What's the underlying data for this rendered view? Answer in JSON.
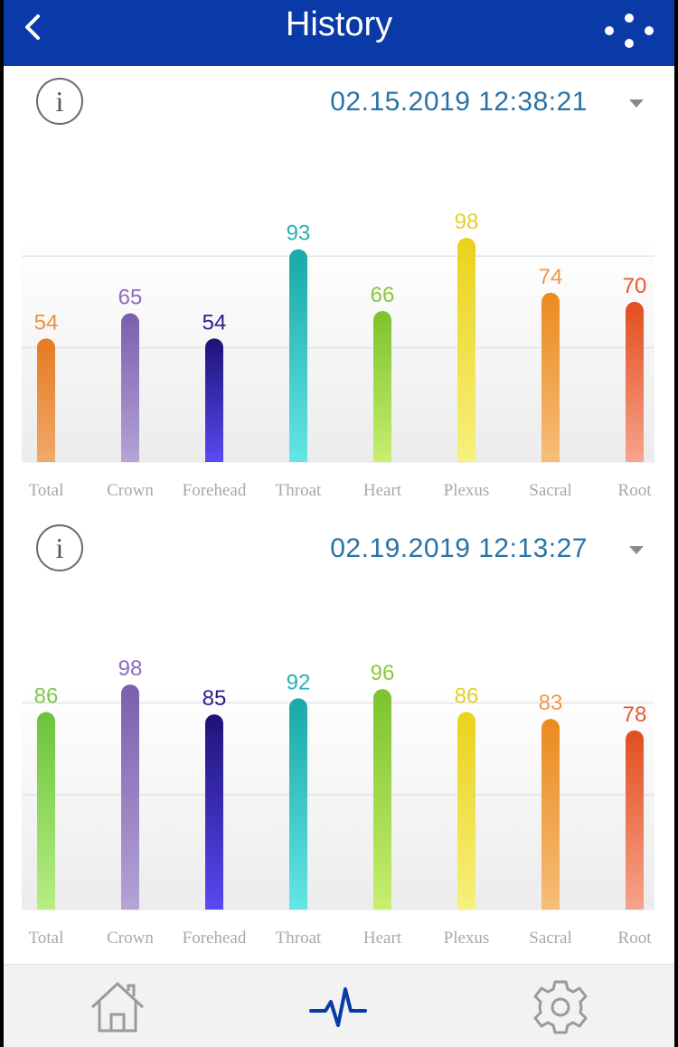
{
  "header": {
    "title": "History",
    "back_icon": "chevron-left-icon",
    "menu_icon": "dots-menu-icon"
  },
  "colors": {
    "header_bg": "#0a3aa8",
    "date_text": "#2874a6",
    "nav_active": "#0a3aa8",
    "nav_inactive": "#9a9a9a"
  },
  "history_entries": [
    {
      "info_label": "i",
      "date": "02.15.2019 12:38:21",
      "chart_data": {
        "type": "bar",
        "categories": [
          "Total",
          "Crown",
          "Forehead",
          "Throat",
          "Heart",
          "Plexus",
          "Sacral",
          "Root"
        ],
        "values": [
          54,
          65,
          54,
          93,
          66,
          98,
          74,
          70
        ],
        "value_labels": [
          "54",
          "65",
          "54",
          "93",
          "66",
          "98",
          "74",
          "70"
        ],
        "ylim": [
          0,
          100
        ],
        "grid": true,
        "colors": [
          [
            "#f0a869",
            "#e67b22"
          ],
          [
            "#b3a3d6",
            "#7b5fae"
          ],
          [
            "#5a48f0",
            "#1d1378"
          ],
          [
            "#62e5e5",
            "#1aa8a8"
          ],
          [
            "#c7ee6f",
            "#7cc32e"
          ],
          [
            "#f7f07c",
            "#ead21a"
          ],
          [
            "#f6bd78",
            "#ea8b1e"
          ],
          [
            "#f5a38a",
            "#e34e1f"
          ]
        ],
        "label_colors": [
          "#ea9142",
          "#8b6cbf",
          "#2a1d8f",
          "#2bb0b0",
          "#89c83c",
          "#e3cf2a",
          "#ec9a45",
          "#e35a2e"
        ]
      }
    },
    {
      "info_label": "i",
      "date": "02.19.2019 12:13:27",
      "chart_data": {
        "type": "bar",
        "categories": [
          "Total",
          "Crown",
          "Forehead",
          "Throat",
          "Heart",
          "Plexus",
          "Sacral",
          "Root"
        ],
        "values": [
          86,
          98,
          85,
          92,
          96,
          86,
          83,
          78
        ],
        "value_labels": [
          "86",
          "98",
          "85",
          "92",
          "96",
          "86",
          "83",
          "78"
        ],
        "ylim": [
          0,
          100
        ],
        "grid": true,
        "colors": [
          [
            "#b6ee84",
            "#6bc43a"
          ],
          [
            "#b3a3d6",
            "#7b5fae"
          ],
          [
            "#5a48f0",
            "#1d1378"
          ],
          [
            "#62e5e5",
            "#1aa8a8"
          ],
          [
            "#c7ee6f",
            "#7cc32e"
          ],
          [
            "#f7f07c",
            "#ead21a"
          ],
          [
            "#f6bd78",
            "#ea8b1e"
          ],
          [
            "#f5a38a",
            "#e34e1f"
          ]
        ],
        "label_colors": [
          "#7cc84a",
          "#8b6cbf",
          "#2a1d8f",
          "#2bb0b0",
          "#89c83c",
          "#e3cf2a",
          "#ec9a45",
          "#e35a2e"
        ]
      }
    }
  ],
  "bottom_nav": {
    "items": [
      {
        "name": "home",
        "icon": "home-icon",
        "active": false
      },
      {
        "name": "history",
        "icon": "pulse-icon",
        "active": true
      },
      {
        "name": "settings",
        "icon": "gear-icon",
        "active": false
      }
    ]
  }
}
